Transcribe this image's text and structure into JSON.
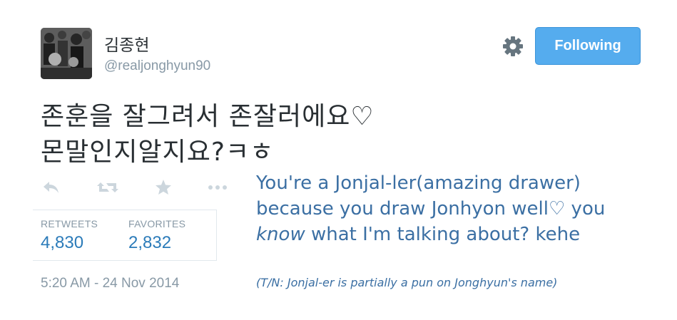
{
  "tweet": {
    "author": {
      "display_name": "김종현",
      "handle": "@realjonghyun90"
    },
    "follow_button_label": "Following",
    "text_lines": [
      "존훈을 잘그려서 존잘러에요♡",
      "몬말인지알지요?ㅋㅎ"
    ],
    "stats": {
      "retweets_label": "RETWEETS",
      "retweets_count": "4,830",
      "favorites_label": "FAVORITES",
      "favorites_count": "2,832"
    },
    "timestamp": "5:20 AM - 24 Nov 2014",
    "actions": [
      "reply-icon",
      "retweet-icon",
      "favorite-icon",
      "more-icon"
    ],
    "icons": {
      "settings": "gear-icon"
    }
  },
  "translation": {
    "line1": "You're a Jonjal-ler(amazing drawer)",
    "line2": "because you draw Jonhyon well♡ you",
    "line3_italic": "know",
    "line3_rest": " what I'm talking about? kehe",
    "note": "(T/N: Jonjal-er is partially a pun on Jonghyun's name)"
  },
  "colors": {
    "accent": "#55acee",
    "link": "#2b7bb9",
    "muted": "#8899a6",
    "text": "#292f33",
    "translation": "#3b6fa3",
    "icon": "#ccd6dd"
  }
}
